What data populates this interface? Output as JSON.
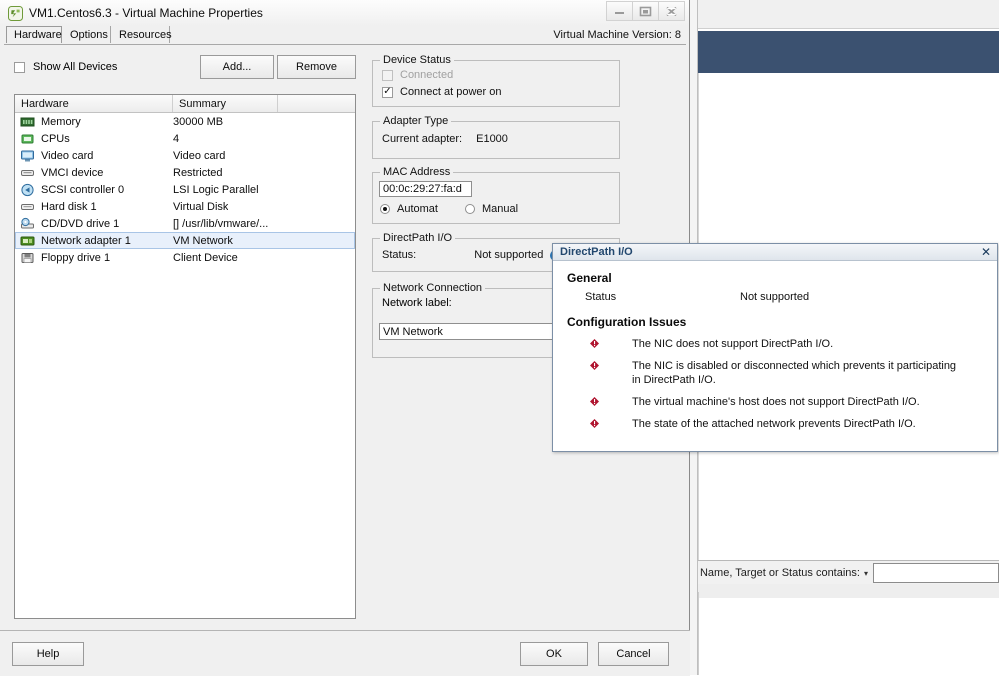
{
  "background": {
    "filter_label": "Name, Target or Status contains:",
    "filter_value": "",
    "filter_placeholder": "",
    "band_color": "#3b5170"
  },
  "window": {
    "title": "VM1.Centos6.3 - Virtual Machine Properties",
    "icon": "vmware-vm-icon",
    "version_text": "Virtual Machine Version: 8",
    "controls": {
      "minimize": "minimize-icon",
      "maximize": "maximize-icon",
      "close": "close-icon"
    },
    "tabs": [
      {
        "label": "Hardware",
        "active": true
      },
      {
        "label": "Options",
        "active": false
      },
      {
        "label": "Resources",
        "active": false
      }
    ]
  },
  "left_panel": {
    "show_all_devices": {
      "label": "Show All Devices",
      "checked": false
    },
    "add_button": "Add...",
    "remove_button": "Remove",
    "columns": [
      "Hardware",
      "Summary",
      ""
    ],
    "rows": [
      {
        "icon": "memory-icon",
        "name": "Memory",
        "summary": "30000 MB",
        "selected": false
      },
      {
        "icon": "cpu-icon",
        "name": "CPUs",
        "summary": "4",
        "selected": false
      },
      {
        "icon": "video-card-icon",
        "name": "Video card",
        "summary": "Video card",
        "selected": false
      },
      {
        "icon": "vmci-device-icon",
        "name": "VMCI device",
        "summary": "Restricted",
        "selected": false
      },
      {
        "icon": "scsi-controller-icon",
        "name": "SCSI controller 0",
        "summary": "LSI Logic Parallel",
        "selected": false
      },
      {
        "icon": "hard-disk-icon",
        "name": "Hard disk 1",
        "summary": "Virtual Disk",
        "selected": false
      },
      {
        "icon": "cd-dvd-icon",
        "name": "CD/DVD drive 1",
        "summary": "[] /usr/lib/vmware/...",
        "selected": false
      },
      {
        "icon": "network-adapter-icon",
        "name": "Network adapter 1",
        "summary": "VM Network",
        "selected": true
      },
      {
        "icon": "floppy-icon",
        "name": "Floppy drive 1",
        "summary": "Client Device",
        "selected": false
      }
    ]
  },
  "right_panel": {
    "device_status": {
      "legend": "Device Status",
      "connected": {
        "label": "Connected",
        "checked": false,
        "disabled": true
      },
      "connect_at_power_on": {
        "label": "Connect at power on",
        "checked": true
      }
    },
    "adapter_type": {
      "legend": "Adapter Type",
      "current_adapter_label": "Current adapter:",
      "current_adapter_value": "E1000"
    },
    "mac_address": {
      "legend": "MAC Address",
      "value": "00:0c:29:27:fa:d",
      "automatic": {
        "label": "Automat",
        "selected": true
      },
      "manual": {
        "label": "Manual",
        "selected": false
      }
    },
    "directpath_io": {
      "legend": "DirectPath I/O",
      "status_label": "Status:",
      "status_value": "Not supported",
      "info_icon": "info-icon"
    },
    "network_connection": {
      "legend": "Network Connection",
      "network_label_label": "Network label:",
      "network_label_value": "VM Network"
    }
  },
  "footer": {
    "help": "Help",
    "ok": "OK",
    "cancel": "Cancel"
  },
  "popup": {
    "title": "DirectPath I/O",
    "close_icon": "close-icon",
    "general_heading": "General",
    "status_label": "Status",
    "status_value": "Not supported",
    "issues_heading": "Configuration Issues",
    "issues": [
      "The NIC does not support DirectPath I/O.",
      "The NIC is disabled or disconnected which prevents it participating in DirectPath I/O.",
      "The virtual machine's host does not support DirectPath I/O.",
      "The state of the attached network prevents DirectPath I/O."
    ],
    "issue_icon": "error-icon",
    "title_color": "#22476e",
    "error_color": "#b01530"
  }
}
